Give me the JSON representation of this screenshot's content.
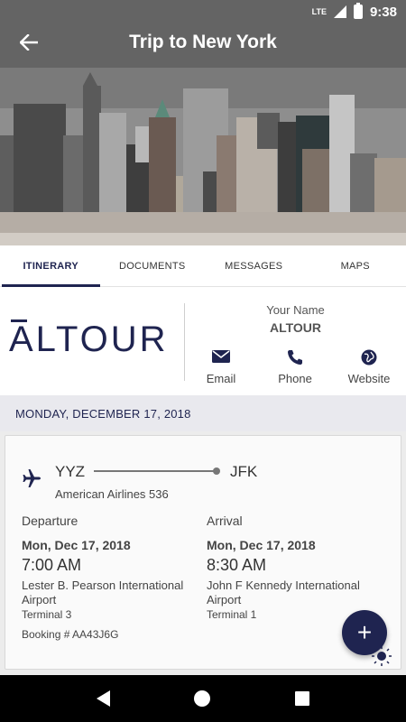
{
  "status_bar": {
    "network": "LTE",
    "time": "9:38"
  },
  "app_bar": {
    "back_icon": "arrow-left-icon",
    "title": "Trip to New York"
  },
  "tabs": [
    {
      "label": "ITINERARY",
      "active": true
    },
    {
      "label": "DOCUMENTS",
      "active": false
    },
    {
      "label": "MESSAGES",
      "active": false
    },
    {
      "label": "MAPS",
      "active": false
    }
  ],
  "agency": {
    "logo_text": "ALTOUR",
    "your_name_label": "Your Name",
    "name": "ALTOUR",
    "contacts": [
      {
        "label": "Email",
        "icon": "envelope-icon"
      },
      {
        "label": "Phone",
        "icon": "phone-icon"
      },
      {
        "label": "Website",
        "icon": "globe-icon"
      }
    ]
  },
  "date_header": "MONDAY, DECEMBER 17, 2018",
  "flight": {
    "icon": "airplane-icon",
    "from": "YYZ",
    "to": "JFK",
    "airline": "American Airlines 536",
    "departure": {
      "label": "Departure",
      "date": "Mon, Dec 17, 2018",
      "time": "7:00 AM",
      "airport": "Lester B. Pearson International Airport",
      "terminal": "Terminal 3"
    },
    "arrival": {
      "label": "Arrival",
      "date": "Mon, Dec 17, 2018",
      "time": "8:30 AM",
      "airport": "John F Kennedy International Airport",
      "terminal": "Terminal 1"
    },
    "booking": "Booking # AA43J6G"
  },
  "fab": {
    "label": "+",
    "icon": "plus-icon"
  },
  "colors": {
    "primary": "#1f2450",
    "date_band": "#e9e9ee"
  }
}
